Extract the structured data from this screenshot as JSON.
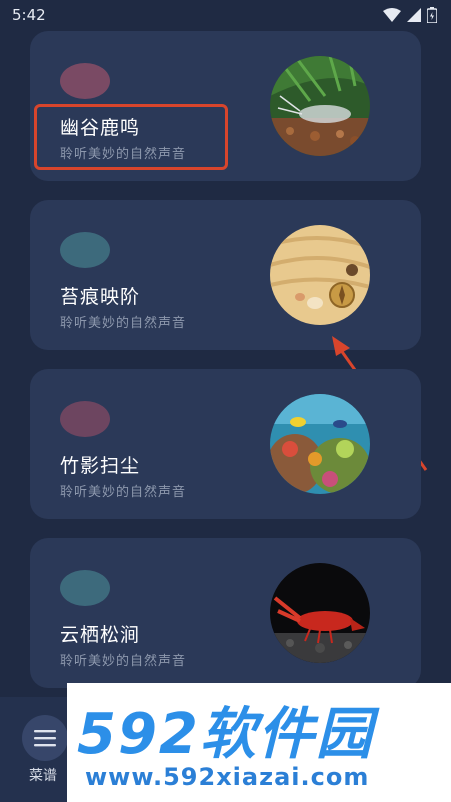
{
  "status_bar": {
    "time": "5:42"
  },
  "cards": [
    {
      "title": "幽谷鹿鸣",
      "subtitle": "聆听美妙的自然声音",
      "dot_color": "#7a4a64",
      "thumb_icon": "shrimp-image"
    },
    {
      "title": "苔痕映阶",
      "subtitle": "聆听美妙的自然声音",
      "dot_color": "#3d6a7c",
      "thumb_icon": "sand-shell-image"
    },
    {
      "title": "竹影扫尘",
      "subtitle": "聆听美妙的自然声音",
      "dot_color": "#6d4560",
      "thumb_icon": "coral-reef-image"
    },
    {
      "title": "云栖松涧",
      "subtitle": "聆听美妙的自然声音",
      "dot_color": "#3d6a7c",
      "thumb_icon": "crayfish-image"
    }
  ],
  "bottom_nav": {
    "menu_label": "菜谱"
  },
  "watermark": {
    "brand": "592软件园",
    "url": "www.592xiazai.com"
  },
  "colors": {
    "background": "#1f2a43",
    "card": "#2b3958",
    "annotation": "#d8452c"
  }
}
